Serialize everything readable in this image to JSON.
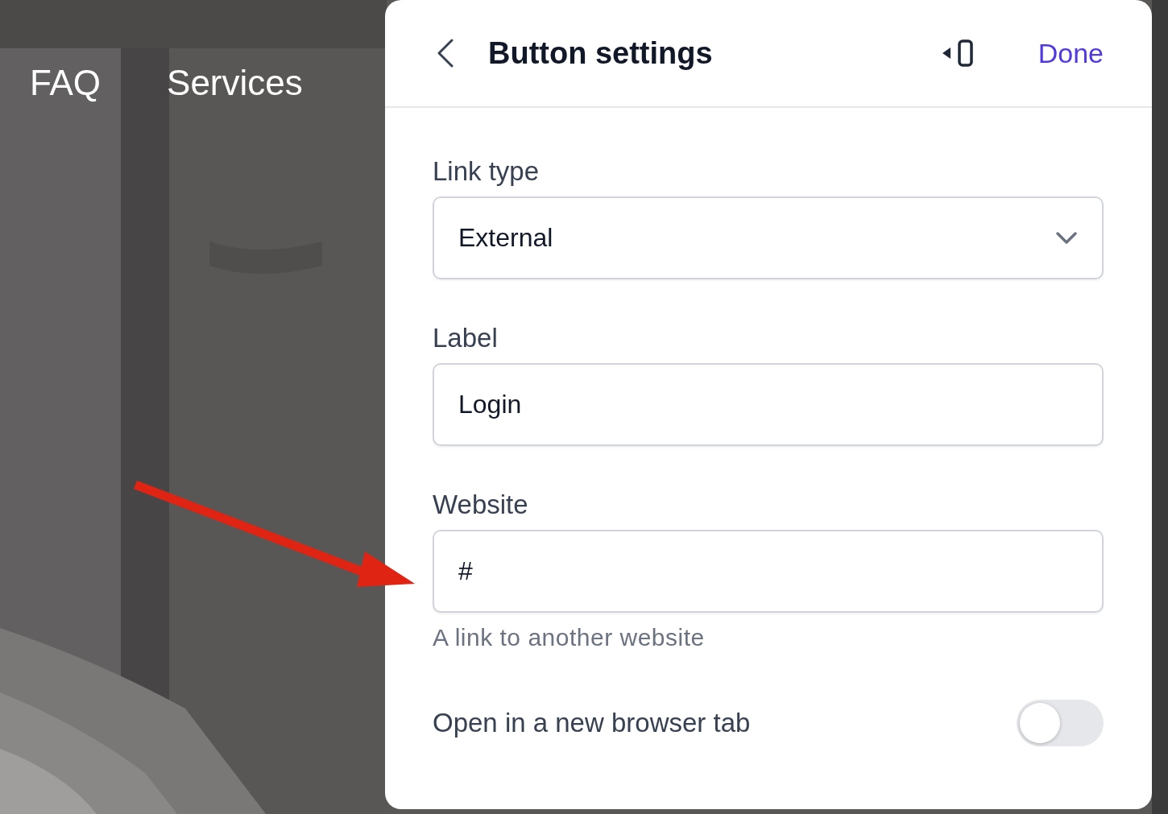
{
  "nav": {
    "items": [
      "FAQ",
      "Services"
    ]
  },
  "panel": {
    "title": "Button settings",
    "action": "Done",
    "fields": [
      {
        "kind": "select",
        "label": "Link type",
        "value": "External"
      },
      {
        "kind": "text",
        "label": "Label",
        "value": "Login"
      },
      {
        "kind": "text",
        "label": "Website",
        "value": "#",
        "hint": "A link to another website"
      }
    ],
    "toggle": {
      "label": "Open in a new browser tab",
      "on": false
    }
  }
}
